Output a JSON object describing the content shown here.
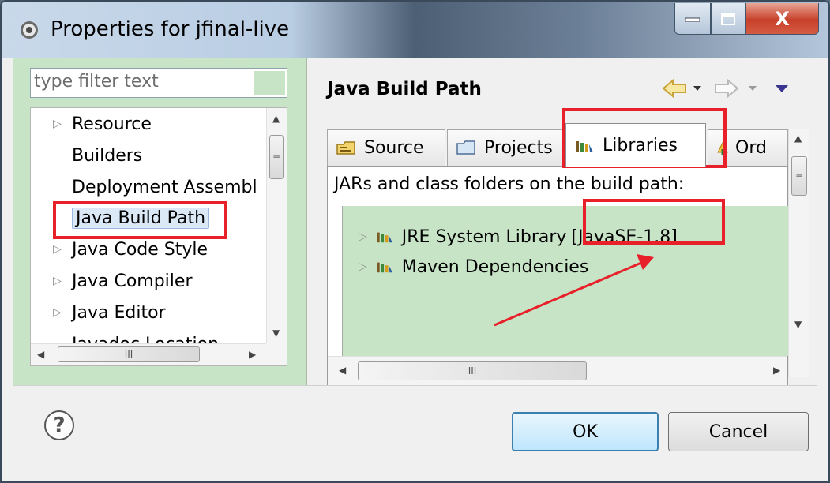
{
  "window": {
    "title": "Properties for jfinal-live",
    "close_glyph": "X"
  },
  "filter": {
    "placeholder": "type filter text"
  },
  "tree": {
    "items": [
      {
        "label": "Resource",
        "expandable": true
      },
      {
        "label": "Builders",
        "expandable": false
      },
      {
        "label": "Deployment Assembl",
        "expandable": false
      },
      {
        "label": "Java Build Path",
        "expandable": false,
        "selected": true
      },
      {
        "label": "Java Code Style",
        "expandable": true
      },
      {
        "label": "Java Compiler",
        "expandable": true
      },
      {
        "label": "Java Editor",
        "expandable": true
      },
      {
        "label": "Javadoc Location",
        "expandable": false
      }
    ],
    "scroll_grip": "≡",
    "hscroll_grip": "III"
  },
  "page": {
    "title": "Java Build Path",
    "tabs": [
      {
        "label": "Source",
        "icon": "source-folder-icon"
      },
      {
        "label": "Projects",
        "icon": "projects-folder-icon"
      },
      {
        "label": "Libraries",
        "icon": "libraries-icon",
        "active": true
      },
      {
        "label": "Ord",
        "icon": "order-export-icon"
      }
    ],
    "panel_label": "JARs and class folders on the build path:",
    "libraries": [
      {
        "label": "JRE System Library",
        "detail": "[JavaSE-1.8]"
      },
      {
        "label": "Maven Dependencies",
        "detail": ""
      }
    ]
  },
  "buttons": {
    "ok": "OK",
    "cancel": "Cancel",
    "help": "?"
  },
  "colors": {
    "annotation": "#e8202a",
    "panel_bg": "#c7e4c7",
    "ok_border": "#3c7fb1"
  }
}
